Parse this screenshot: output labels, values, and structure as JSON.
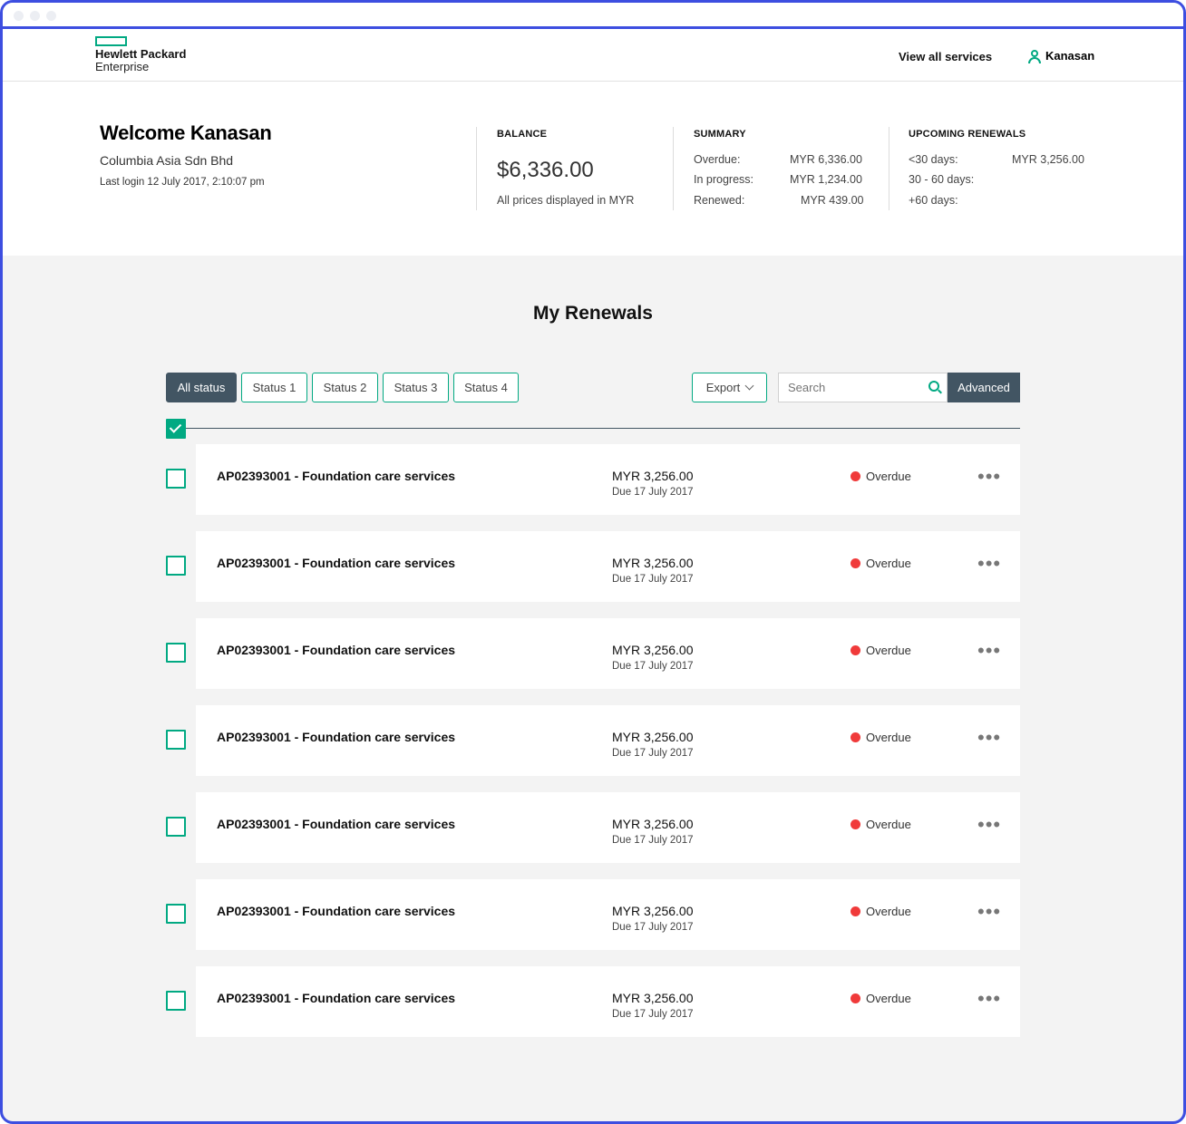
{
  "header": {
    "logo_line1": "Hewlett Packard",
    "logo_line2": "Enterprise",
    "view_all_services": "View all services",
    "user_name": "Kanasan"
  },
  "hero": {
    "welcome": "Welcome Kanasan",
    "company": "Columbia Asia Sdn Bhd",
    "last_login": "Last login 12 July 2017, 2:10:07 pm",
    "balance": {
      "title": "BALANCE",
      "value": "$6,336.00",
      "note": "All prices displayed in MYR"
    },
    "summary": {
      "title": "SUMMARY",
      "rows": [
        {
          "label": "Overdue:",
          "value": "MYR 6,336.00"
        },
        {
          "label": "In progress:",
          "value": "MYR 1,234.00"
        },
        {
          "label": "Renewed:",
          "value": "MYR 439.00"
        }
      ]
    },
    "upcoming": {
      "title": "UPCOMING RENEWALS",
      "rows": [
        {
          "label": "<30 days:",
          "value": "MYR 3,256.00"
        },
        {
          "label": "30 - 60 days:",
          "value": ""
        },
        {
          "label": "+60 days:",
          "value": ""
        }
      ]
    }
  },
  "main": {
    "title": "My Renewals",
    "filters": [
      "All status",
      "Status 1",
      "Status 2",
      "Status 3",
      "Status 4"
    ],
    "export_label": "Export",
    "search_placeholder": "Search",
    "advanced_label": "Advanced"
  },
  "renewals": [
    {
      "title": "AP02393001 - Foundation care services",
      "amount": "MYR 3,256.00",
      "due": "Due 17 July 2017",
      "status": "Overdue"
    },
    {
      "title": "AP02393001 - Foundation care services",
      "amount": "MYR 3,256.00",
      "due": "Due 17 July 2017",
      "status": "Overdue"
    },
    {
      "title": "AP02393001 - Foundation care services",
      "amount": "MYR 3,256.00",
      "due": "Due 17 July 2017",
      "status": "Overdue"
    },
    {
      "title": "AP02393001 - Foundation care services",
      "amount": "MYR 3,256.00",
      "due": "Due 17 July 2017",
      "status": "Overdue"
    },
    {
      "title": "AP02393001 - Foundation care services",
      "amount": "MYR 3,256.00",
      "due": "Due 17 July 2017",
      "status": "Overdue"
    },
    {
      "title": "AP02393001 - Foundation care services",
      "amount": "MYR 3,256.00",
      "due": "Due 17 July 2017",
      "status": "Overdue"
    },
    {
      "title": "AP02393001 - Foundation care services",
      "amount": "MYR 3,256.00",
      "due": "Due 17 July 2017",
      "status": "Overdue"
    }
  ],
  "colors": {
    "accent": "#01a982",
    "slate": "#425563",
    "overdue": "#f03a3a",
    "frame": "#3d4ee0"
  }
}
